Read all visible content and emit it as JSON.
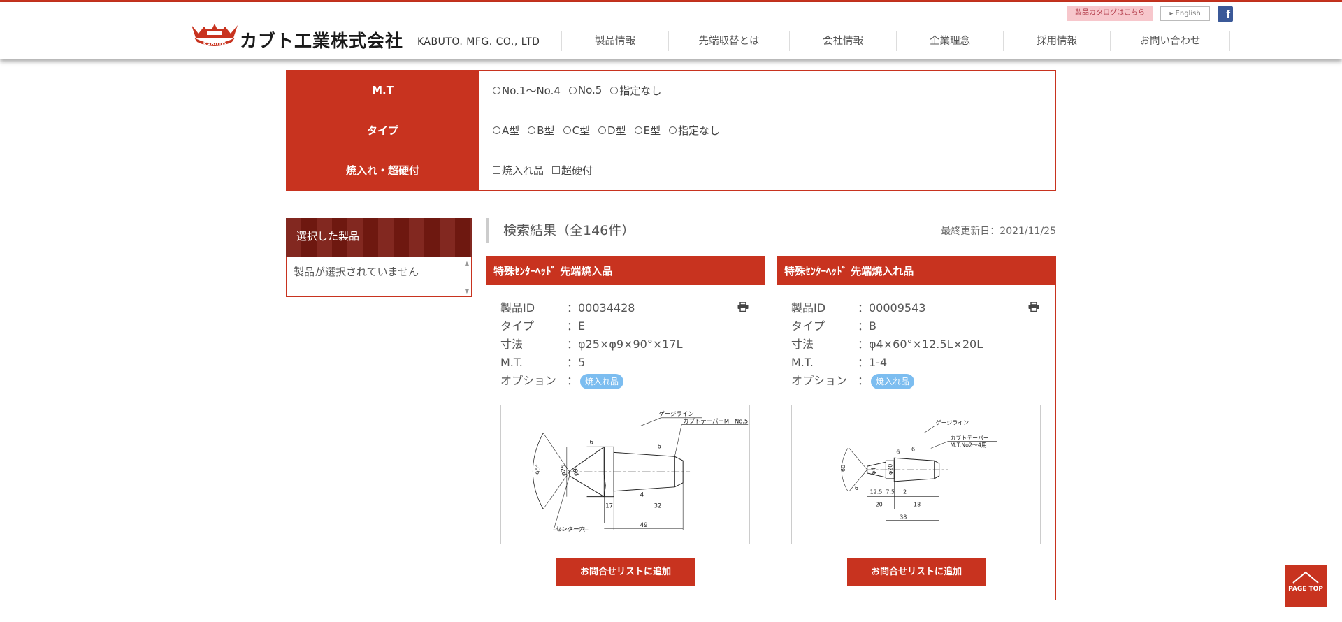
{
  "header": {
    "logo_mark_text": "KABUTO",
    "company_name_jp": "カブト工業株式会社",
    "company_name_en": "KABUTO. MFG. CO., LTD",
    "catalog_link": "製品カタログはこちら",
    "english_link": "English",
    "facebook_icon": "facebook-icon",
    "nav": [
      "製品情報",
      "先端取替とは",
      "会社情報",
      "企業理念",
      "採用情報",
      "お問い合わせ"
    ]
  },
  "filters": {
    "mt": {
      "label": "M.T",
      "options": [
        "No.1～No.4",
        "No.5",
        "指定なし"
      ]
    },
    "type": {
      "label": "タイプ",
      "options": [
        "A型",
        "B型",
        "C型",
        "D型",
        "E型",
        "指定なし"
      ]
    },
    "hardening": {
      "label": "焼入れ・超硬付",
      "options": [
        "焼入れ品",
        "超硬付"
      ]
    }
  },
  "sidebar": {
    "title": "選択した製品",
    "empty_text": "製品が選択されていません"
  },
  "results": {
    "title": "検索結果（全146件）",
    "last_updated": "最終更新日：2021/11/25"
  },
  "labels": {
    "id": "製品ID",
    "type": "タイプ",
    "dims": "寸法",
    "mt": "M.T.",
    "option": "オプション"
  },
  "cards": [
    {
      "title": "特殊ｾﾝﾀｰﾍｯﾄﾞ 先端焼入品",
      "id": "：00034428",
      "type": "：E",
      "dims": "：φ25×φ9×90°×17L",
      "mt": "：5",
      "option_sep": "：",
      "option_badge": "焼入れ品",
      "add_button": "お問合せリストに追加",
      "drawing": {
        "gauge_line": "ゲージライン",
        "taper": "カブトテーパーM.TNo.5",
        "center_hole": "センター穴",
        "angle": "90°",
        "d1": "φ25",
        "d2": "φ9",
        "rough": "6",
        "dim_4": "4",
        "dim_17": "17",
        "dim_32": "32",
        "dim_49": "49"
      }
    },
    {
      "title": "特殊ｾﾝﾀｰﾍｯﾄﾞ 先端焼入れ品",
      "id": "：00009543",
      "type": "：B",
      "dims": "：φ4×60°×12.5L×20L",
      "mt": "：1-4",
      "option_sep": "：",
      "option_badge": "焼入れ品",
      "add_button": "お問合せリストに追加",
      "drawing": {
        "gauge_line": "ゲージライン",
        "taper": "カブトテーパー",
        "taper2": "M.T.No2～4用",
        "angle": "60",
        "d1": "φ4",
        "d2": "φ20",
        "rough": "6",
        "dim_125": "12.5",
        "dim_75": "7.5",
        "dim_2": "2",
        "dim_20": "20",
        "dim_18": "18",
        "dim_38": "38"
      }
    }
  ],
  "page_top": "PAGE TOP"
}
